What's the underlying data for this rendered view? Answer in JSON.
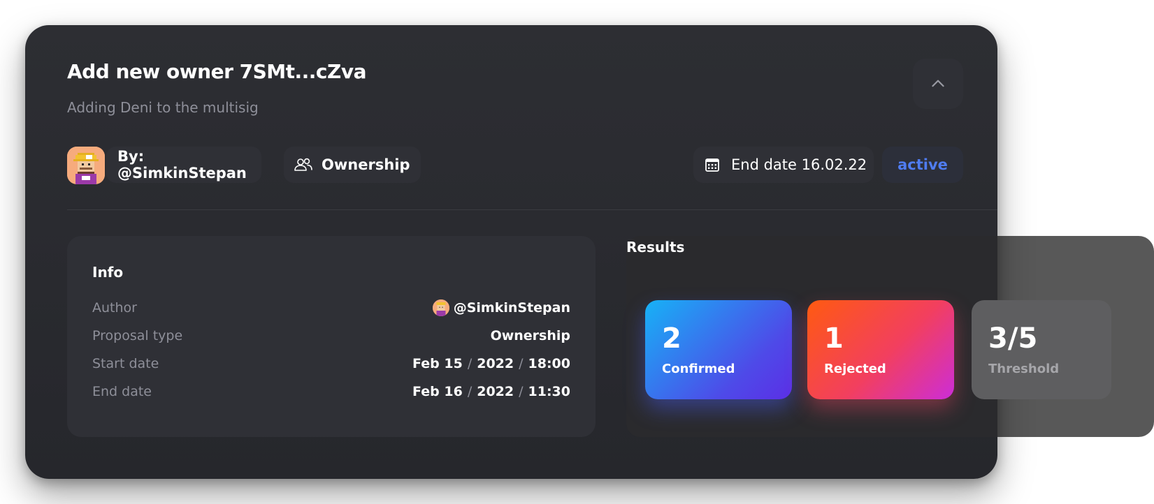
{
  "proposal": {
    "title": "Add new owner 7SMt...cZva",
    "subtitle": "Adding Deni to the multisig",
    "author_chip": "By: @SimkinStepan",
    "type_chip": "Ownership",
    "end_chip": "End date 16.02.22",
    "status": "active"
  },
  "info": {
    "title": "Info",
    "rows": [
      {
        "label": "Author",
        "value": "@SimkinStepan"
      },
      {
        "label": "Proposal type",
        "value": "Ownership"
      },
      {
        "label": "Start date",
        "date": "Feb 15",
        "year": "2022",
        "time": "18:00"
      },
      {
        "label": "End date",
        "date": "Feb 16",
        "year": "2022",
        "time": "11:30"
      }
    ]
  },
  "results": {
    "title": "Results",
    "confirmed": {
      "value": "2",
      "label": "Confirmed"
    },
    "rejected": {
      "value": "1",
      "label": "Rejected"
    },
    "threshold": {
      "value": "3/5",
      "label": "Threshold"
    }
  },
  "colors": {
    "status_accent": "#4f7cf0",
    "confirmed_gradient": [
      "#17b2f6",
      "#5b2fe6"
    ],
    "rejected_gradient": [
      "#ff5a11",
      "#cc2dd8"
    ]
  },
  "icons": {
    "collapse": "chevron-up-icon",
    "type": "users-icon",
    "end_date": "calendar-icon",
    "avatar": "pixel-avatar"
  }
}
